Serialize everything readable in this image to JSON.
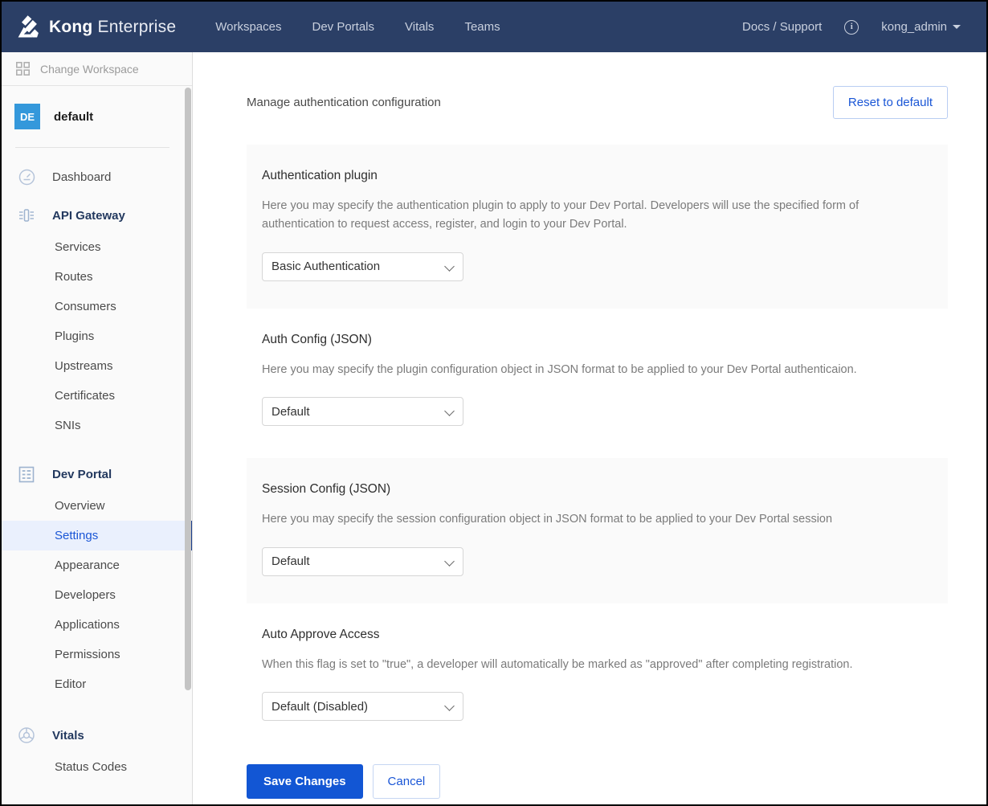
{
  "header": {
    "logo_icon": "kong-gorilla-logo-icon",
    "brand_bold": "Kong",
    "brand_light": "Enterprise",
    "nav": [
      {
        "label": "Workspaces"
      },
      {
        "label": "Dev Portals"
      },
      {
        "label": "Vitals"
      },
      {
        "label": "Teams"
      }
    ],
    "docs_support": "Docs / Support",
    "info_icon_glyph": "i",
    "user": "kong_admin"
  },
  "sidebar": {
    "change_workspace": "Change Workspace",
    "change_workspace_icon": "grid-icon",
    "workspace_badge": "DE",
    "workspace_name": "default",
    "groups": [
      {
        "label": "Dashboard",
        "icon": "gauge-icon",
        "accent": false,
        "items": []
      },
      {
        "label": "API Gateway",
        "icon": "api-gateway-icon",
        "accent": true,
        "items": [
          {
            "label": "Services",
            "active": false
          },
          {
            "label": "Routes",
            "active": false
          },
          {
            "label": "Consumers",
            "active": false
          },
          {
            "label": "Plugins",
            "active": false
          },
          {
            "label": "Upstreams",
            "active": false
          },
          {
            "label": "Certificates",
            "active": false
          },
          {
            "label": "SNIs",
            "active": false
          }
        ]
      },
      {
        "label": "Dev Portal",
        "icon": "document-list-icon",
        "accent": true,
        "items": [
          {
            "label": "Overview",
            "active": false
          },
          {
            "label": "Settings",
            "active": true
          },
          {
            "label": "Appearance",
            "active": false
          },
          {
            "label": "Developers",
            "active": false
          },
          {
            "label": "Applications",
            "active": false
          },
          {
            "label": "Permissions",
            "active": false
          },
          {
            "label": "Editor",
            "active": false
          }
        ]
      },
      {
        "label": "Vitals",
        "icon": "vitals-donut-icon",
        "accent": true,
        "items": [
          {
            "label": "Status Codes",
            "active": false
          }
        ]
      }
    ]
  },
  "main": {
    "page_title": "Manage authentication configuration",
    "reset_button": "Reset to default",
    "sections": [
      {
        "shaded": true,
        "title": "Authentication plugin",
        "description": "Here you may specify the authentication plugin to apply to your Dev Portal. Developers will use the specified form of authentication to request access, register, and login to your Dev Portal.",
        "select_value": "Basic Authentication",
        "select_name": "authentication-plugin-select"
      },
      {
        "shaded": false,
        "title": "Auth Config (JSON)",
        "description": "Here you may specify the plugin configuration object in JSON format to be applied to your Dev Portal authenticaion.",
        "select_value": "Default",
        "select_name": "auth-config-select"
      },
      {
        "shaded": true,
        "title": "Session Config (JSON)",
        "description": "Here you may specify the session configuration object in JSON format to be applied to your Dev Portal session",
        "select_value": "Default",
        "select_name": "session-config-select"
      },
      {
        "shaded": false,
        "title": "Auto Approve Access",
        "description": "When this flag is set to \"true\", a developer will automatically be marked as \"approved\" after completing registration.",
        "select_value": "Default (Disabled)",
        "select_name": "auto-approve-access-select"
      }
    ],
    "save_button": "Save Changes",
    "cancel_button": "Cancel"
  },
  "colors": {
    "header_bg": "#2b3f66",
    "accent_blue": "#1256d4",
    "link_blue": "#1a56d6",
    "badge_blue": "#3498db",
    "card_bg": "#fafafa"
  }
}
